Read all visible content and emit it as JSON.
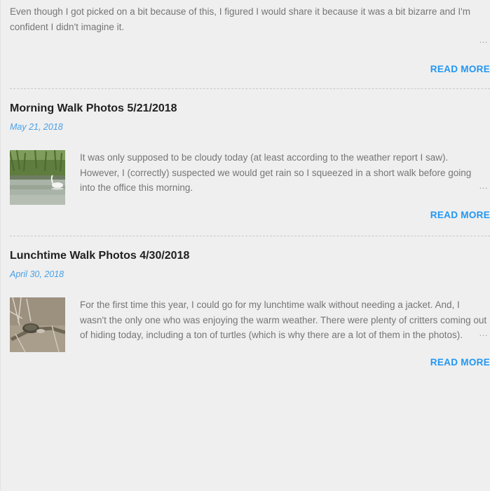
{
  "posts": [
    {
      "snippet": "Even though I got picked on a bit because of this, I figured I would share it because it was a bit bizarre and I'm confident I didn't imagine it.",
      "ellipsis": "…",
      "read_more": "READ MORE"
    },
    {
      "title": "Morning Walk Photos 5/21/2018",
      "date": "May 21, 2018",
      "thumbnail": "swan-on-pond-photo",
      "snippet": "It was only supposed to be cloudy today (at least according to the weather report I saw). However, I (correctly) suspected we would get rain so I squeezed in a short walk before going into the office this morning.",
      "ellipsis": "…",
      "read_more": "READ MORE"
    },
    {
      "title": "Lunchtime Walk Photos 4/30/2018",
      "date": "April 30, 2018",
      "thumbnail": "turtles-on-log-photo",
      "snippet": "For the first time this year, I could go for my lunchtime walk without needing a jacket. And, I wasn't the only one who was enjoying the warm weather. There were plenty of critters coming out of hiding today, including a ton of turtles (which is why there are a lot of them in the photos).",
      "ellipsis": "…",
      "read_more": "READ MORE"
    }
  ],
  "colors": {
    "background": "#efefef",
    "title": "#212121",
    "date": "#4aa0e6",
    "link": "#2196f3",
    "text": "#757575"
  }
}
